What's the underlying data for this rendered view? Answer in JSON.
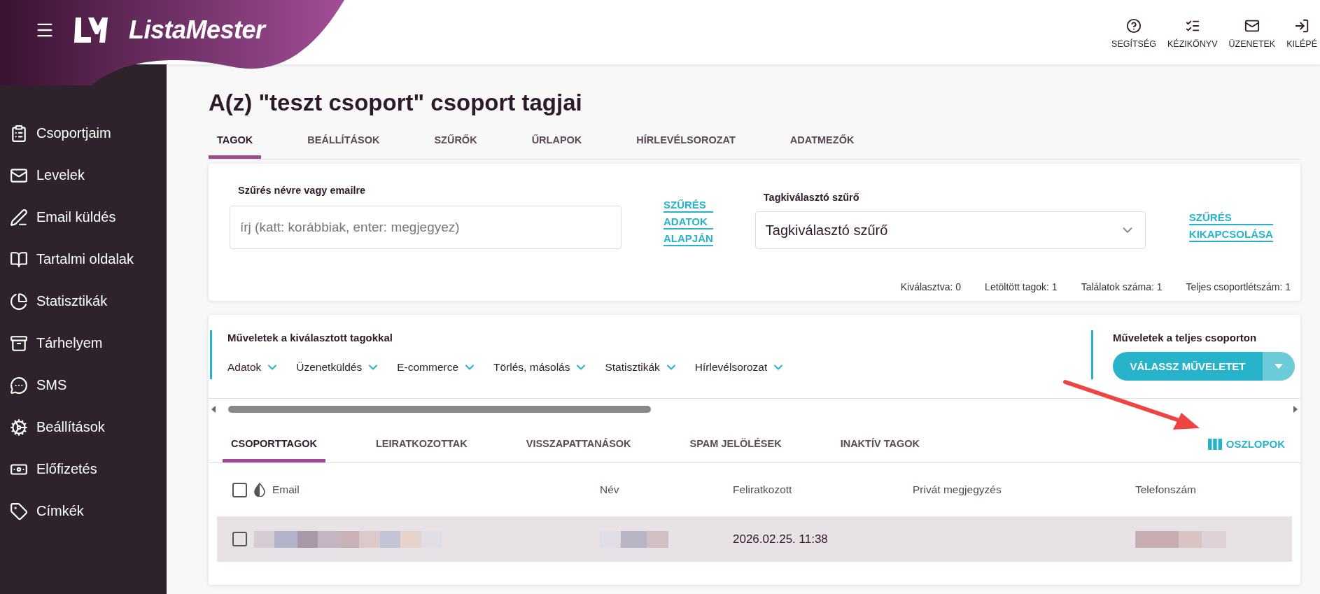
{
  "header": {
    "brand": "ListaMester",
    "actions": [
      {
        "label": "SEGÍTSÉG"
      },
      {
        "label": "KÉZIKÖNYV"
      },
      {
        "label": "ÜZENETEK"
      },
      {
        "label": "KILÉPÉ"
      }
    ]
  },
  "sidebar": {
    "items": [
      {
        "label": "Csoportjaim"
      },
      {
        "label": "Levelek"
      },
      {
        "label": "Email küldés"
      },
      {
        "label": "Tartalmi oldalak"
      },
      {
        "label": "Statisztikák"
      },
      {
        "label": "Tárhelyem"
      },
      {
        "label": "SMS"
      },
      {
        "label": "Beállítások"
      },
      {
        "label": "Előfizetés"
      },
      {
        "label": "Címkék"
      }
    ]
  },
  "title": "A(z) \"teszt csoport\" csoport tagjai",
  "tabs": [
    {
      "label": "TAGOK",
      "selected": true
    },
    {
      "label": "BEÁLLÍTÁSOK",
      "selected": false
    },
    {
      "label": "SZŰRŐK",
      "selected": false
    },
    {
      "label": "ŰRLAPOK",
      "selected": false
    },
    {
      "label": "HÍRLEVÉLSOROZAT",
      "selected": false
    },
    {
      "label": "ADATMEZŐK",
      "selected": false
    }
  ],
  "filter_panel": {
    "search": {
      "label": "Szűrés névre vagy emailre",
      "placeholder": "írj (katt: korábbiak, enter: megjegyez)"
    },
    "search_link": [
      "SZŰRÉS",
      "ADATOK",
      "ALAPJÁN"
    ],
    "member_filter": {
      "label": "Tagkiválasztó szűrő",
      "value": "Tagkiválasztó szűrő"
    },
    "disable_link": [
      "SZŰRÉS",
      "KIKAPCSOLÁSA"
    ],
    "stats": [
      "Kiválasztva: 0",
      "Letöltött tagok: 1",
      "Találatok száma: 1",
      "Teljes csoportlétszám: 1"
    ]
  },
  "operations": {
    "selected_title": "Műveletek a kiválasztott tagokkal",
    "menus": [
      "Adatok",
      "Üzenetküldés",
      "E-commerce",
      "Törlés, másolás",
      "Statisztikák",
      "Hírlevélsorozat"
    ],
    "group_title": "Műveletek a teljes csoporton",
    "group_button": "VÁLASSZ MŰVELETET"
  },
  "subtabs": [
    {
      "label": "CSOPORTTAGOK",
      "selected": true
    },
    {
      "label": "LEIRATKOZOTTAK",
      "selected": false
    },
    {
      "label": "VISSZAPATTANÁSOK",
      "selected": false
    },
    {
      "label": "SPAM JELÖLÉSEK",
      "selected": false
    },
    {
      "label": "INAKTÍV TAGOK",
      "selected": false
    }
  ],
  "columns_button": "OSZLOPOK",
  "table": {
    "select_all": {
      "checked": false
    },
    "columns": [
      "Email",
      "Név",
      "Feliratkozott",
      "Privát megjegyzés",
      "Telefonszám"
    ],
    "rows": [
      {
        "checked": false,
        "subscribed": "2026.02.25. 11:38"
      }
    ]
  }
}
